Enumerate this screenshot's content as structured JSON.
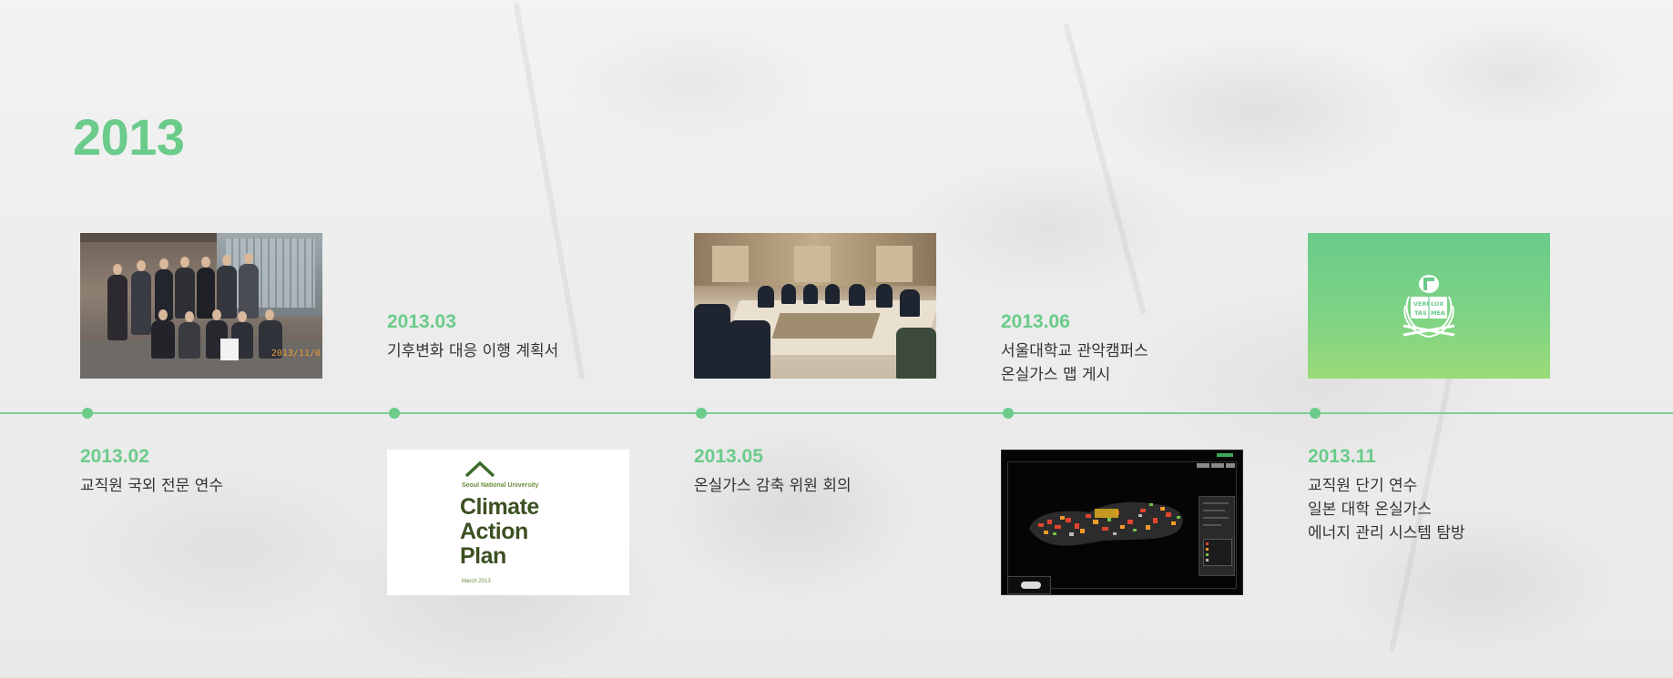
{
  "year": "2013",
  "entries": [
    {
      "date": "2013.02",
      "lines": [
        "교직원 국외 전문 연수"
      ],
      "image": "staff-group-photo"
    },
    {
      "date": "2013.03",
      "lines": [
        "기후변화 대응 이행 계획서"
      ],
      "image": "climate-action-plan-cover"
    },
    {
      "date": "2013.05",
      "lines": [
        "온실가스 감축 위원 회의"
      ],
      "image": "committee-meeting-photo"
    },
    {
      "date": "2013.06",
      "lines": [
        "서울대학교 관악캠퍼스",
        "온실가스 맵 게시"
      ],
      "image": "campus-ghg-map-screenshot"
    },
    {
      "date": "2013.11",
      "lines": [
        "교직원 단기 연수",
        "일본 대학 온실가스",
        "에너지 관리 시스템 탐방"
      ],
      "image": "snu-emblem"
    }
  ],
  "cover": {
    "university": "Seoul National University",
    "title_lines": [
      "Climate",
      "Action",
      "Plan"
    ],
    "month": "March 2013"
  },
  "photo_stamp": "2013/11/0",
  "emblem_text": [
    "VERI",
    "LUX",
    "TAS",
    "MEA"
  ],
  "colors": {
    "accent": "#6acb8a",
    "timeline": "#7ccf96",
    "text": "#333333",
    "emblem_gradient_top": "#6acb8a",
    "emblem_gradient_bottom": "#9bdb78"
  }
}
